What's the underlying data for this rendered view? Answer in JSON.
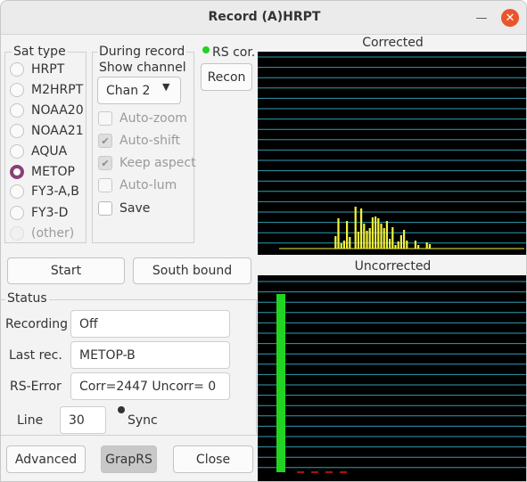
{
  "window": {
    "title": "Record (A)HRPT"
  },
  "sat_type": {
    "title": "Sat type",
    "selected": "METOP",
    "items": [
      {
        "label": "HRPT",
        "enabled": true
      },
      {
        "label": "M2HRPT",
        "enabled": true
      },
      {
        "label": "NOAA20",
        "enabled": true
      },
      {
        "label": "NOAA21",
        "enabled": true
      },
      {
        "label": "AQUA",
        "enabled": true
      },
      {
        "label": "METOP",
        "enabled": true
      },
      {
        "label": "FY3-A,B",
        "enabled": true
      },
      {
        "label": "FY3-D",
        "enabled": true
      },
      {
        "label": "(other)",
        "enabled": false
      }
    ]
  },
  "during_record": {
    "title": "During record",
    "show_channel_label": "Show channel",
    "channel_value": "Chan 2",
    "options": [
      {
        "label": "Auto-zoom",
        "checked": false,
        "enabled": false
      },
      {
        "label": "Auto-shift",
        "checked": true,
        "enabled": false
      },
      {
        "label": "Keep aspect",
        "checked": true,
        "enabled": false
      },
      {
        "label": "Auto-lum",
        "checked": false,
        "enabled": false
      },
      {
        "label": "Save",
        "checked": false,
        "enabled": true
      }
    ]
  },
  "rs": {
    "label": "RS cor.",
    "indicator_color": "#22d322",
    "recon_label": "Recon"
  },
  "actions": {
    "start_label": "Start",
    "south_bound_label": "South bound"
  },
  "status": {
    "title": "Status",
    "recording_label": "Recording",
    "recording_value": "Off",
    "last_rec_label": "Last rec.",
    "last_rec_value": "METOP-B",
    "rs_error_label": "RS-Error",
    "rs_error_value": "Corr=2447  Uncorr=  0",
    "line_label": "Line",
    "line_value": "30",
    "sync_label": "Sync",
    "sync_indicator_color": "#333333"
  },
  "footer": {
    "advanced_label": "Advanced",
    "graprs_label": "GrapRS",
    "close_label": "Close"
  },
  "corrected_plot": {
    "title": "Corrected",
    "bar_color": "#f3f33b",
    "grid_color": "#2f9db3",
    "values": [
      0,
      0,
      0,
      0,
      0,
      0,
      0,
      0,
      0,
      0,
      0,
      0,
      0,
      0,
      0,
      0,
      0,
      0,
      0,
      0,
      0,
      0,
      0,
      0,
      0,
      0,
      14,
      34,
      6,
      9,
      31,
      13,
      0,
      47,
      19,
      45,
      28,
      20,
      23,
      35,
      36,
      34,
      28,
      23,
      31,
      11,
      24,
      4,
      8,
      15,
      21,
      9,
      0,
      0,
      9,
      4,
      0,
      0,
      7,
      5
    ]
  },
  "uncorrected_plot": {
    "title": "Uncorrected",
    "bar_color": "#22d322",
    "grid_color": "#2f9db3",
    "marker_color": "#a01515",
    "values": [
      200
    ]
  }
}
